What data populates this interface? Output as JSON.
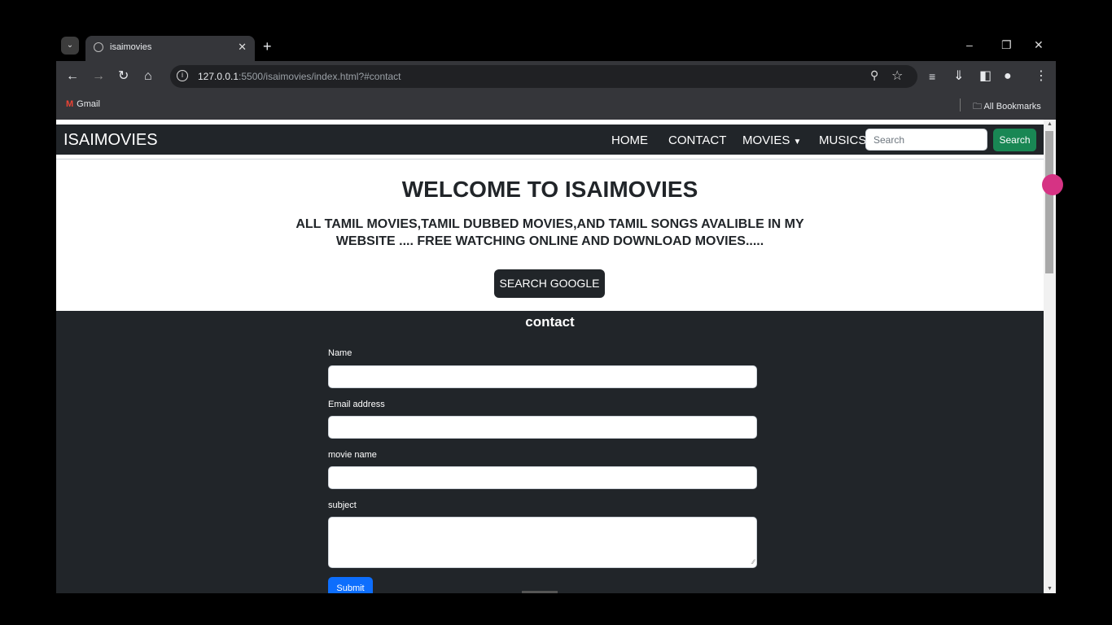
{
  "browser": {
    "tab_title": "isaimovies",
    "url_host": "127.0.0.1",
    "url_rest": ":5500/isaimovies/index.html?#contact",
    "bookmark_gmail": "Gmail",
    "all_bookmarks": "All Bookmarks",
    "icons": [
      "tab-search-icon",
      "globe-icon",
      "close-icon",
      "plus-icon",
      "minimize-icon",
      "restore-icon",
      "window-close-icon",
      "back-icon",
      "forward-icon",
      "reload-icon",
      "home-icon",
      "info-icon",
      "zoom-icon",
      "star-icon",
      "media-icon",
      "download-icon",
      "sidepanel-icon",
      "profile-icon",
      "menu-icon",
      "folder-icon"
    ]
  },
  "navbar": {
    "brand": "ISAIMOVIES",
    "links": [
      "HOME",
      "CONTACT",
      "MOVIES",
      "MUSICS"
    ],
    "search_placeholder": "Search",
    "search_button": "Search"
  },
  "hero": {
    "title": "WELCOME TO ISAIMOVIES",
    "subtitle": "ALL TAMIL MOVIES,TAMIL DUBBED MOVIES,AND TAMIL SONGS AVALIBLE IN MY WEBSITE .... FREE WATCHING ONLINE AND DOWNLOAD MOVIES.....",
    "button": "SEARCH GOOGLE"
  },
  "contact": {
    "title": "contact",
    "fields": {
      "name_label": "Name",
      "email_label": "Email address",
      "movie_label": "movie name",
      "subject_label": "subject"
    },
    "submit": "Submit"
  },
  "colors": {
    "navbar_bg": "#212529",
    "search_btn": "#198754",
    "submit_btn": "#0d6efd",
    "accent_dot": "#d63384"
  }
}
